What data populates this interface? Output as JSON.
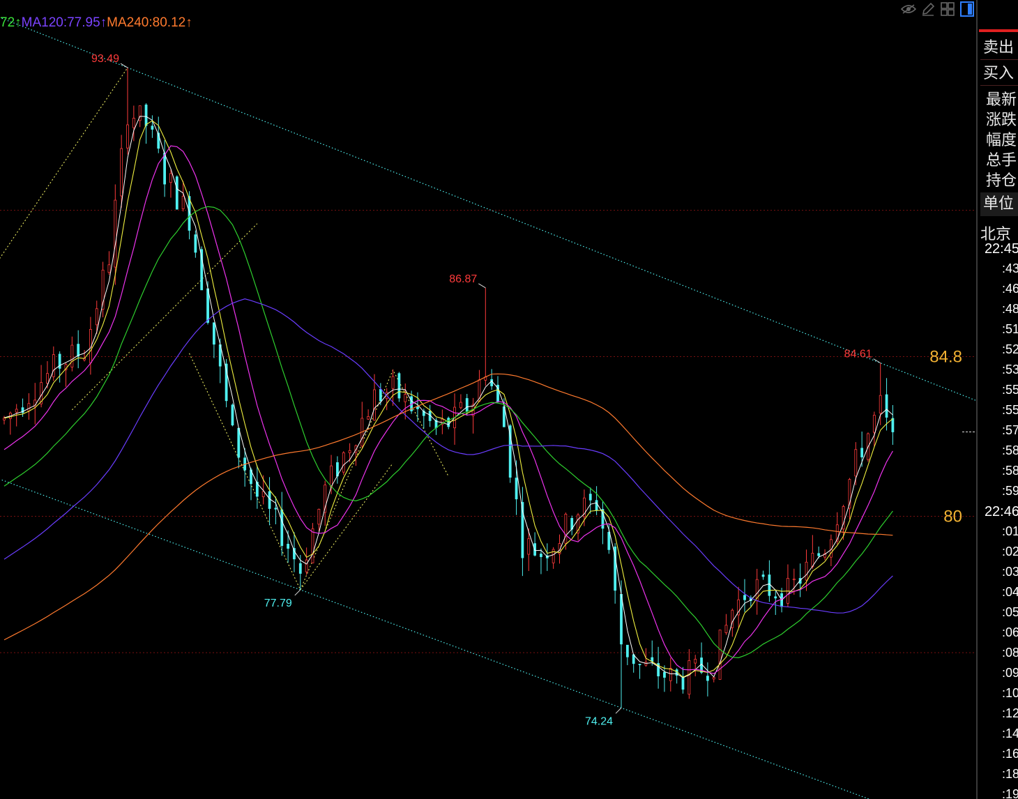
{
  "legend": [
    {
      "text": "72",
      "color": "#3adf3a"
    },
    {
      "text": "↑",
      "color": "#3adf3a"
    },
    {
      "text": "MA120:77.95",
      "color": "#7a43ff"
    },
    {
      "text": "↑",
      "color": "#7a43ff"
    },
    {
      "text": "MA240:80.12",
      "color": "#ff7a2e"
    },
    {
      "text": "↑",
      "color": "#ff7a2e"
    }
  ],
  "toolbar": {
    "icons": [
      "eye-hide-icon",
      "pencil-icon",
      "grid-icon",
      "panel-icon"
    ]
  },
  "sidebar": {
    "sell_label": "卖出",
    "buy_label": "买入",
    "info_labels": [
      "最新",
      "涨跌",
      "幅度",
      "总手",
      "持仓"
    ],
    "unit_label": "单位",
    "city_label": "北京",
    "time_ticks": [
      "22:45",
      ":43",
      ":46",
      ":48",
      ":51",
      ":52",
      ":53",
      ":55",
      ":55",
      ":57",
      ":58",
      ":58",
      ":59",
      "22:46",
      ":01",
      ":02",
      ":03",
      ":04",
      ":05",
      ":06",
      ":08",
      ":09",
      ":10",
      ":12",
      ":14",
      ":16",
      ":18",
      ":19"
    ]
  },
  "chart_data": {
    "type": "candlestick",
    "y_range": [
      71.5,
      95.0
    ],
    "annotations": {
      "highs": [
        {
          "label": "93.49",
          "value": 93.49,
          "bar": 20
        },
        {
          "label": "86.87",
          "value": 86.87,
          "bar": 78
        },
        {
          "label": "84.61",
          "value": 84.61,
          "bar": 142
        }
      ],
      "lows": [
        {
          "label": "77.79",
          "value": 77.79,
          "bar": 48
        },
        {
          "label": "74.24",
          "value": 74.24,
          "bar": 100
        }
      ],
      "levels": [
        {
          "label": "84.8",
          "value": 84.8
        },
        {
          "label": "80",
          "value": 80
        }
      ]
    },
    "ma_series": [
      {
        "name": "MA120",
        "value": 77.95
      },
      {
        "name": "MA240",
        "value": 80.12
      }
    ],
    "colors": {
      "up": "#ff3b3b",
      "down": "#4ff0f0",
      "high_label": "#ff3b3b",
      "low_label": "#4ff0f0",
      "level_label": "#f3b233",
      "trend": "#4ff0f0",
      "pattern": "#e8e860",
      "grid": "#7a1010",
      "ma_fast": "#ffffff",
      "ma_yellow": "#f0f040",
      "ma_magenta": "#ee33ee",
      "ma_green": "#2ecf2e",
      "ma_blue": "#6a3dff",
      "ma_orange": "#ff7a2e"
    }
  }
}
